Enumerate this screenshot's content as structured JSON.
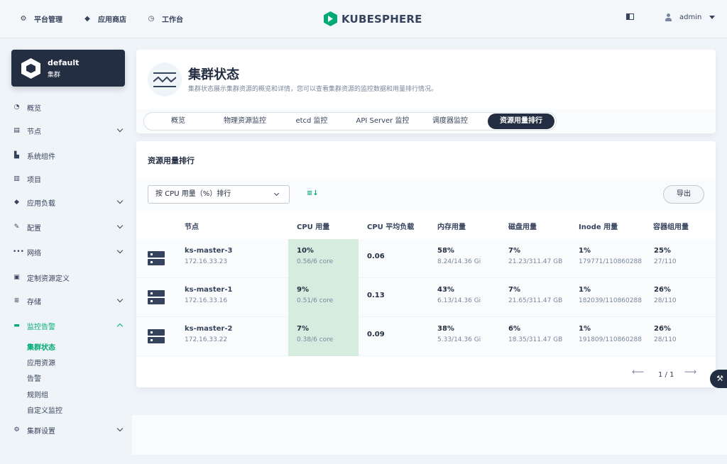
{
  "topnav": {
    "items": [
      {
        "label": "平台管理",
        "icon": "gear-icon"
      },
      {
        "label": "应用商店",
        "icon": "layers-icon"
      },
      {
        "label": "工作台",
        "icon": "clock-icon"
      }
    ],
    "logo_text": "KUBESPHERE",
    "user": "admin"
  },
  "cluster": {
    "name": "default",
    "label": "集群"
  },
  "sidebar": {
    "items": [
      {
        "label": "概览",
        "icon": "gauge-icon"
      },
      {
        "label": "节点",
        "icon": "server-icon"
      },
      {
        "label": "系统组件",
        "icon": "component-icon"
      },
      {
        "label": "项目",
        "icon": "project-icon"
      },
      {
        "label": "应用负载",
        "icon": "stack-icon"
      },
      {
        "label": "配置",
        "icon": "wrench-icon"
      },
      {
        "label": "网络",
        "icon": "network-icon"
      },
      {
        "label": "定制资源定义",
        "icon": "crd-icon"
      },
      {
        "label": "存储",
        "icon": "database-icon"
      },
      {
        "label": "监控告警",
        "icon": "monitor-icon"
      },
      {
        "label": "集群设置",
        "icon": "settings-icon"
      }
    ],
    "monitor_sub": [
      "集群状态",
      "应用资源",
      "告警",
      "规则组",
      "自定义监控"
    ]
  },
  "header": {
    "title": "集群状态",
    "description": "集群状态展示集群资源的概览和详情，您可以查看集群资源的监控数据和用量排行情况。",
    "tabs": [
      "概览",
      "物理资源监控",
      "etcd 监控",
      "API Server 监控",
      "调度器监控",
      "资源用量排行"
    ]
  },
  "ranking": {
    "title": "资源用量排行",
    "sort_select": "按 CPU 用量（%）排行",
    "export": "导出",
    "columns": [
      "节点",
      "CPU 用量",
      "CPU 平均负载",
      "内存用量",
      "磁盘用量",
      "Inode 用量",
      "容器组用量"
    ],
    "rows": [
      {
        "name": "ks-master-3",
        "ip": "172.16.33.23",
        "cpu": "10%",
        "cpu_detail": "0.56/6 core",
        "load": "0.06",
        "mem": "58%",
        "mem_detail": "8.24/14.36 Gi",
        "disk": "7%",
        "disk_detail": "21.23/311.47 GB",
        "inode": "1%",
        "inode_detail": "179771/110860288",
        "pods": "25%",
        "pods_detail": "27/110"
      },
      {
        "name": "ks-master-1",
        "ip": "172.16.33.16",
        "cpu": "9%",
        "cpu_detail": "0.51/6 core",
        "load": "0.13",
        "mem": "43%",
        "mem_detail": "6.13/14.36 Gi",
        "disk": "7%",
        "disk_detail": "21.65/311.47 GB",
        "inode": "1%",
        "inode_detail": "182039/110860288",
        "pods": "26%",
        "pods_detail": "28/110"
      },
      {
        "name": "ks-master-2",
        "ip": "172.16.33.22",
        "cpu": "7%",
        "cpu_detail": "0.38/6 core",
        "load": "0.09",
        "mem": "38%",
        "mem_detail": "5.33/14.36 Gi",
        "disk": "6%",
        "disk_detail": "18.35/311.47 GB",
        "inode": "1%",
        "inode_detail": "191809/110860288",
        "pods": "26%",
        "pods_detail": "28/110"
      }
    ],
    "pagination": "1 / 1"
  }
}
